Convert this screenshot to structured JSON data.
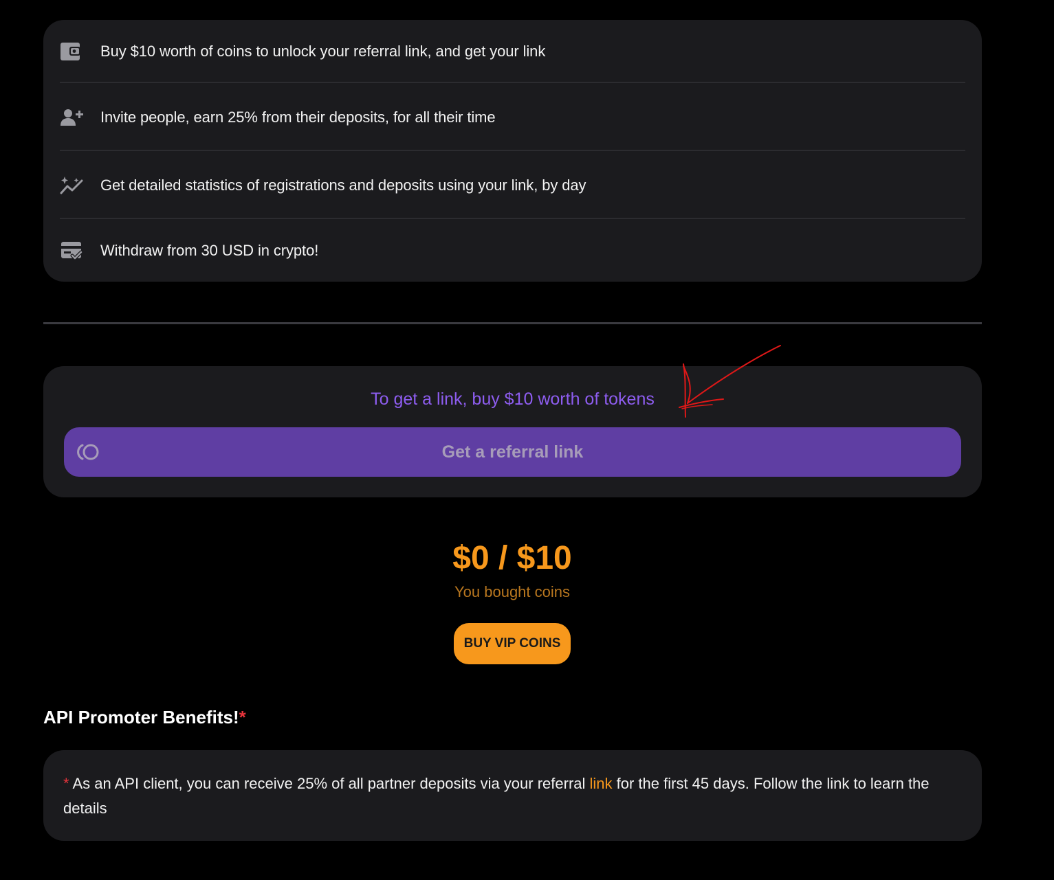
{
  "benefits": {
    "items": [
      {
        "icon": "wallet-icon",
        "text": "Buy $10 worth of coins to unlock your referral link, and get your link"
      },
      {
        "icon": "user-plus-icon",
        "text": "Invite people, earn 25% from their deposits, for all their time"
      },
      {
        "icon": "sparkle-chart-icon",
        "text": "Get detailed statistics of registrations and deposits using your link, by day"
      },
      {
        "icon": "card-check-icon",
        "text": "Withdraw from 30 USD in crypto!"
      }
    ]
  },
  "referral": {
    "hint": "To get a link, buy $10 worth of tokens",
    "button_label": "Get a referral link"
  },
  "progress": {
    "value": "$0 / $10",
    "label": "You bought coins",
    "bought": 0,
    "required": 10
  },
  "buy_button": {
    "label": "BUY VIP COINS"
  },
  "api": {
    "heading": "API Promoter Benefits!",
    "required_mark": "*",
    "note_mark": "*",
    "note_before": " As an API client, you can receive 25% of all partner deposits via your referral ",
    "note_link": "link",
    "note_after": " for the first 45 days. Follow the link to learn the details"
  },
  "colors": {
    "accent_purple": "#8e5df0",
    "button_purple": "#5f3ea3",
    "accent_orange": "#f7981c",
    "card_background": "#1b1b1e",
    "required_red": "#e8343c"
  }
}
